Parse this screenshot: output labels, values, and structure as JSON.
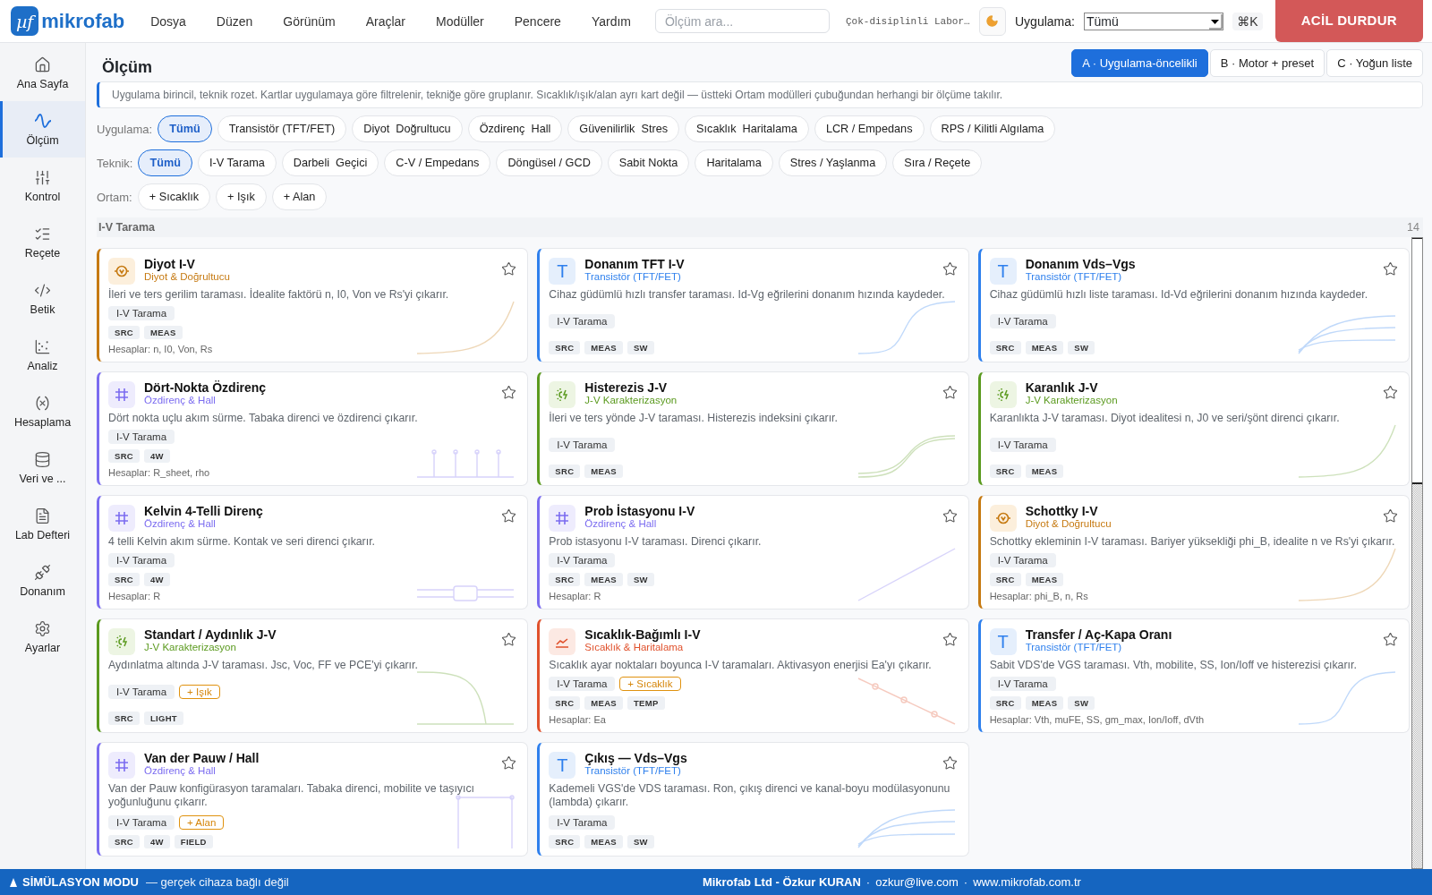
{
  "topbar": {
    "logo_mark": "µf",
    "logo_text": "mikrofab",
    "menu": [
      "Dosya",
      "Düzen",
      "Görünüm",
      "Araçlar",
      "Modüller",
      "Pencere",
      "Yardım"
    ],
    "search": {
      "placeholder": "Ölçüm ara..."
    },
    "lab_name": "Çok-disiplinli Labor…",
    "app_label": "Uygulama:",
    "app_select": "Tümü",
    "shortcut": "⌘K",
    "emergency": "ACİL DURDUR"
  },
  "sidebar": {
    "items": [
      {
        "label": "Ana Sayfa",
        "selected": false
      },
      {
        "label": "Ölçüm",
        "selected": true
      },
      {
        "label": "Kontrol",
        "selected": false
      },
      {
        "label": "Reçete",
        "selected": false
      },
      {
        "label": "Betik",
        "selected": false
      },
      {
        "label": "Analiz",
        "selected": false
      },
      {
        "label": "Hesaplama",
        "selected": false
      },
      {
        "label": "Veri ve ...",
        "selected": false
      },
      {
        "label": "Lab Defteri",
        "selected": false
      },
      {
        "label": "Donanım",
        "selected": false
      },
      {
        "label": "Ayarlar",
        "selected": false
      }
    ]
  },
  "page": {
    "title": "Ölçüm",
    "layouts": [
      {
        "label": "A · Uygulama-öncelikli",
        "selected": true
      },
      {
        "label": "B · Motor + preset",
        "selected": false
      },
      {
        "label": "C · Yoğun liste",
        "selected": false
      }
    ],
    "info": "Uygulama birincil, teknik rozet. Kartlar uygulamaya göre filtrelenir, tekniğe göre gruplanır. Sıcaklık/ışık/alan ayrı kart değil — üstteki Ortam modülleri çubuğundan herhangi bir ölçüme takılır."
  },
  "filters": [
    {
      "label": "Uygulama:",
      "chips": [
        {
          "label": "Tümü",
          "selected": true
        },
        {
          "label": "Transistör (TFT/FET)",
          "selected": false
        },
        {
          "label": "Diyot  Doğrultucu",
          "selected": false
        },
        {
          "label": "Özdirenç  Hall",
          "selected": false
        },
        {
          "label": "Güvenilirlik  Stres",
          "selected": false
        },
        {
          "label": "Sıcaklık  Haritalama",
          "selected": false
        },
        {
          "label": "LCR / Empedans",
          "selected": false
        },
        {
          "label": "RPS / Kilitli Algılama",
          "selected": false
        }
      ]
    },
    {
      "label": "Teknik:",
      "chips": [
        {
          "label": "Tümü",
          "selected": true
        },
        {
          "label": "I-V Tarama",
          "selected": false
        },
        {
          "label": "Darbeli  Geçici",
          "selected": false
        },
        {
          "label": "C-V / Empedans",
          "selected": false
        },
        {
          "label": "Döngüsel / GCD",
          "selected": false
        },
        {
          "label": "Sabit Nokta",
          "selected": false
        },
        {
          "label": "Haritalama",
          "selected": false
        },
        {
          "label": "Stres / Yaşlanma",
          "selected": false
        },
        {
          "label": "Sıra / Reçete",
          "selected": false
        }
      ]
    },
    {
      "label": "Ortam:",
      "chips": [
        {
          "label": "+ Sıcaklık",
          "selected": false
        },
        {
          "label": "+ Işık",
          "selected": false
        },
        {
          "label": "+ Alan",
          "selected": false
        }
      ]
    }
  ],
  "section": {
    "title": "I-V Tarama",
    "count": "14"
  },
  "cards": [
    {
      "kind": "diode",
      "title": "Diyot I-V",
      "category": "Diyot & Doğrultucu",
      "description": "İleri ve ters gerilim taraması. İdealite faktörü n, I0, Von ve Rs'yi çıkarır.",
      "technique": "I-V Tarama",
      "tags": [
        "SRC",
        "MEAS"
      ],
      "calc": "Hesaplar: n, I0, Von, Rs",
      "starred": false
    },
    {
      "kind": "transistor",
      "icon_text": "T",
      "title": "Donanım TFT I-V",
      "category": "Transistör (TFT/FET)",
      "description": "Cihaz güdümlü hızlı transfer taraması. Id-Vg eğrilerini donanım hızında kaydeder.",
      "technique": "I-V Tarama",
      "tags": [
        "SRC",
        "MEAS",
        "SW"
      ],
      "starred": false
    },
    {
      "kind": "transistor",
      "icon_text": "T",
      "title": "Donanım Vds–Vgs",
      "category": "Transistör (TFT/FET)",
      "description": "Cihaz güdümlü hızlı liste taraması. Id-Vd eğrilerini donanım hızında kaydeder.",
      "technique": "I-V Tarama",
      "tags": [
        "SRC",
        "MEAS",
        "SW"
      ],
      "starred": false
    },
    {
      "kind": "resist",
      "title": "Dört-Nokta Özdirenç",
      "category": "Özdirenç & Hall",
      "description": "Dört nokta uçlu akım sürme. Tabaka direnci ve özdirenci çıkarır.",
      "technique": "I-V Tarama",
      "tags": [
        "SRC",
        "4W"
      ],
      "calc": "Hesaplar: R_sheet, rho",
      "starred": false
    },
    {
      "kind": "jv",
      "title": "Histerezis J-V",
      "category": "J-V Karakterizasyon",
      "description": "İleri ve ters yönde J-V taraması. Histerezis indeksini çıkarır.",
      "technique": "I-V Tarama",
      "tags": [
        "SRC",
        "MEAS"
      ],
      "starred": false
    },
    {
      "kind": "jv",
      "title": "Karanlık J-V",
      "category": "J-V Karakterizasyon",
      "description": "Karanlıkta J-V taraması. Diyot idealitesi n, J0 ve seri/şönt direnci çıkarır.",
      "technique": "I-V Tarama",
      "tags": [
        "SRC",
        "MEAS"
      ],
      "starred": false
    },
    {
      "kind": "resist",
      "title": "Kelvin 4-Telli Direnç",
      "category": "Özdirenç & Hall",
      "description": "4 telli Kelvin akım sürme. Kontak ve seri direnci çıkarır.",
      "technique": "I-V Tarama",
      "tags": [
        "SRC",
        "4W"
      ],
      "calc": "Hesaplar: R",
      "starred": false
    },
    {
      "kind": "resist",
      "title": "Prob İstasyonu I-V",
      "category": "Özdirenç & Hall",
      "description": "Prob istasyonu I-V taraması. Direnci çıkarır.",
      "technique": "I-V Tarama",
      "tags": [
        "SRC",
        "MEAS",
        "SW"
      ],
      "calc": "Hesaplar: R",
      "starred": false
    },
    {
      "kind": "diode",
      "title": "Schottky I-V",
      "category": "Diyot & Doğrultucu",
      "description": "Schottky ekleminin I-V taraması. Bariyer yüksekliği phi_B, idealite n ve Rs'yi çıkarır.",
      "technique": "I-V Tarama",
      "tags": [
        "SRC",
        "MEAS"
      ],
      "calc": "Hesaplar: phi_B, n, Rs",
      "starred": false
    },
    {
      "kind": "jv",
      "title": "Standart / Aydınlık J-V",
      "category": "J-V Karakterizasyon",
      "description": "Aydınlatma altında J-V taraması. Jsc, Voc, FF ve PCE'yi çıkarır.",
      "technique": "I-V Tarama",
      "environment": "+ Işık",
      "tags": [
        "SRC",
        "LIGHT"
      ],
      "starred": false
    },
    {
      "kind": "temp",
      "title": "Sıcaklık-Bağımlı I-V",
      "category": "Sıcaklık & Haritalama",
      "description": "Sıcaklık ayar noktaları boyunca I-V taramaları. Aktivasyon enerjisi Ea'yı çıkarır.",
      "technique": "I-V Tarama",
      "environment": "+ Sıcaklık",
      "tags": [
        "SRC",
        "MEAS",
        "TEMP"
      ],
      "calc": "Hesaplar: Ea",
      "starred": false
    },
    {
      "kind": "transistor",
      "icon_text": "T",
      "title": "Transfer / Aç-Kapa Oranı",
      "category": "Transistör (TFT/FET)",
      "description": "Sabit VDS'de VGS taraması. Vth, mobilite, SS, Ion/Ioff ve histerezisi çıkarır.",
      "technique": "I-V Tarama",
      "tags": [
        "SRC",
        "MEAS",
        "SW"
      ],
      "calc": "Hesaplar: Vth, muFE, SS, gm_max, Ion/Ioff, dVth",
      "starred": false
    },
    {
      "kind": "resist",
      "title": "Van der Pauw / Hall",
      "category": "Özdirenç & Hall",
      "description": "Van der Pauw konfigürasyon taramaları. Tabaka direnci, mobilite ve taşıyıcı yoğunluğunu çıkarır.",
      "technique": "I-V Tarama",
      "environment": "+ Alan",
      "tags": [
        "SRC",
        "4W",
        "FIELD"
      ],
      "starred": false
    },
    {
      "kind": "transistor",
      "icon_text": "T",
      "title": "Çıkış — Vds–Vgs",
      "category": "Transistör (TFT/FET)",
      "description": "Kademeli VGS'de VDS taraması. Ron, çıkış direnci ve kanal-boyu modülasyonunu (lambda) çıkarır.",
      "technique": "I-V Tarama",
      "tags": [
        "SRC",
        "MEAS",
        "SW"
      ],
      "starred": false
    }
  ],
  "status_bar": {
    "mode": "SİMÜLASYON MODU",
    "mode_note": "— gerçek cihaza bağlı değil",
    "company": "Mikrofab Ltd - Özkur KURAN",
    "separators": [
      "·",
      "·"
    ],
    "email": "ozkur@live.com",
    "website": "www.mikrofab.com.tr"
  }
}
